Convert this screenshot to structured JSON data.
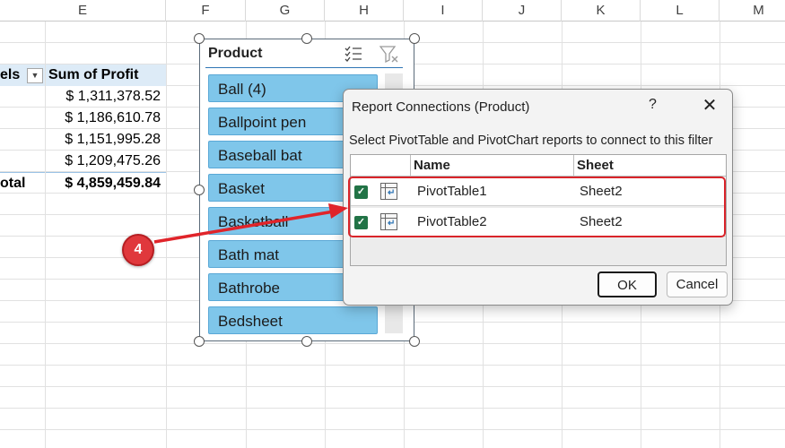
{
  "columns": [
    "E",
    "F",
    "G",
    "H",
    "I",
    "J",
    "K",
    "L",
    "M"
  ],
  "pivot": {
    "header_left": "els",
    "header_sum": "Sum of Profit",
    "values": [
      "$ 1,311,378.52",
      "$ 1,186,610.78",
      "$ 1,151,995.28",
      "$ 1,209,475.26"
    ],
    "total_label": "otal",
    "total_value": "$ 4,859,459.84"
  },
  "slicer": {
    "title": "Product",
    "multi_select_icon": "multi-select-icon",
    "clear_filter_icon": "clear-filter-icon",
    "items": [
      "Ball (4)",
      "Ballpoint pen",
      "Baseball bat",
      "Basket",
      "Basketball",
      "Bath mat",
      "Bathrobe",
      "Bedsheet"
    ]
  },
  "dialog": {
    "title": "Report Connections (Product)",
    "help": "?",
    "close": "✕",
    "instruction": "Select PivotTable and PivotChart reports to connect to this filter",
    "columns": {
      "name": "Name",
      "sheet": "Sheet"
    },
    "rows": [
      {
        "checked": true,
        "name": "PivotTable1",
        "sheet": "Sheet2"
      },
      {
        "checked": true,
        "name": "PivotTable2",
        "sheet": "Sheet2"
      }
    ],
    "ok_label": "OK",
    "cancel_label": "Cancel"
  },
  "annotation": {
    "step": "4",
    "color": "#e0383c"
  }
}
